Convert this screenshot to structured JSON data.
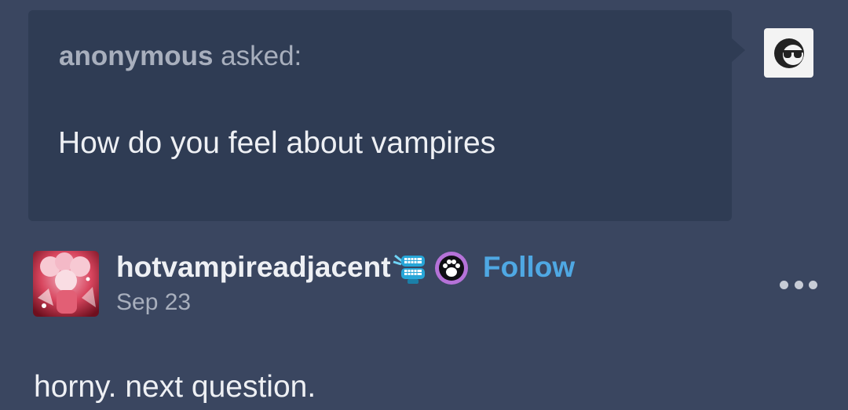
{
  "ask": {
    "asker": "anonymous",
    "verb": "asked:",
    "question": "How do you feel about vampires",
    "avatar_icon": "sunglasses-face-icon"
  },
  "post": {
    "username": "hotvampireadjacent",
    "badges": [
      "chattering-teeth-badge-icon",
      "paw-print-badge-icon"
    ],
    "follow_label": "Follow",
    "date": "Sep 23",
    "body": "horny. next question.",
    "menu_icon": "more-options-icon"
  },
  "colors": {
    "background": "#3a4660",
    "ask_bubble": "#2f3c54",
    "follow": "#4fa8e3",
    "text_primary": "#eef0f4",
    "text_secondary": "#a8afbd"
  }
}
